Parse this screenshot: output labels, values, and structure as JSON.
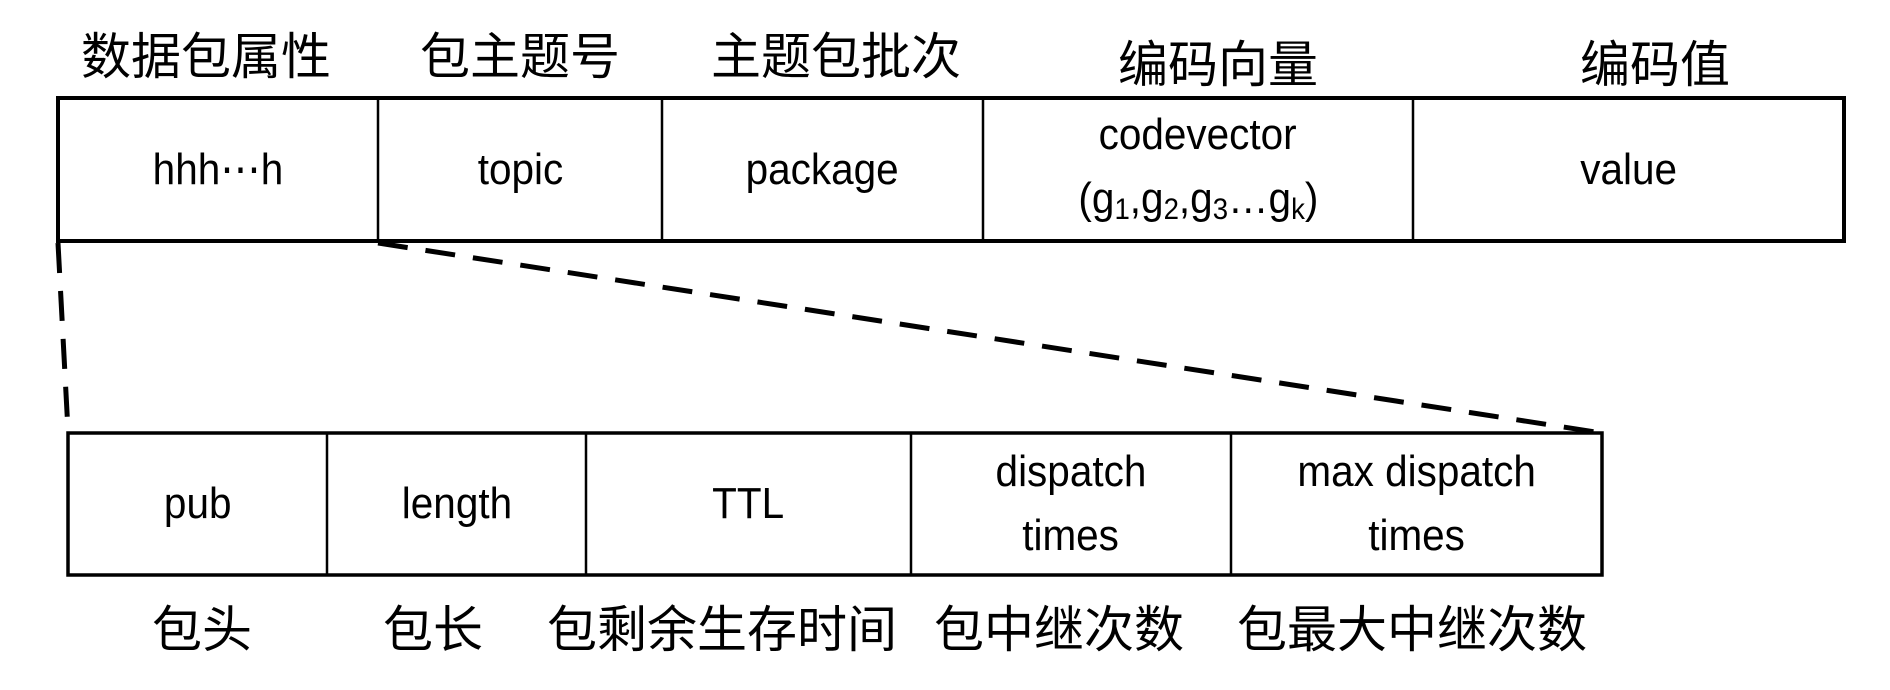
{
  "top_labels": [
    "数据包属性",
    "包主题号",
    "主题包批次",
    "编码向量",
    "编码值"
  ],
  "top_cells": [
    {
      "line1": "hhh⋯h"
    },
    {
      "line1": "topic"
    },
    {
      "line1": "package"
    },
    {
      "line1": "codevector",
      "line2": {
        "open": "(",
        "items": [
          {
            "base": "g",
            "sub": "1"
          },
          {
            "base": "g",
            "sub": "2"
          },
          {
            "base": "g",
            "sub": "3"
          },
          {
            "base": "g",
            "sub": "k"
          }
        ],
        "close": ")"
      }
    },
    {
      "line1": "value"
    }
  ],
  "bottom_cells": [
    {
      "line1": "pub"
    },
    {
      "line1": "length"
    },
    {
      "line1": "TTL"
    },
    {
      "line1": "dispatch",
      "line2": "times"
    },
    {
      "line1": "max dispatch",
      "line2": "times"
    }
  ],
  "bottom_labels": [
    "包头",
    "包长",
    "包剩余生存时间",
    "包中继次数",
    "包最大中继次数"
  ],
  "colors": {
    "line": "#000000",
    "background": "#ffffff"
  }
}
